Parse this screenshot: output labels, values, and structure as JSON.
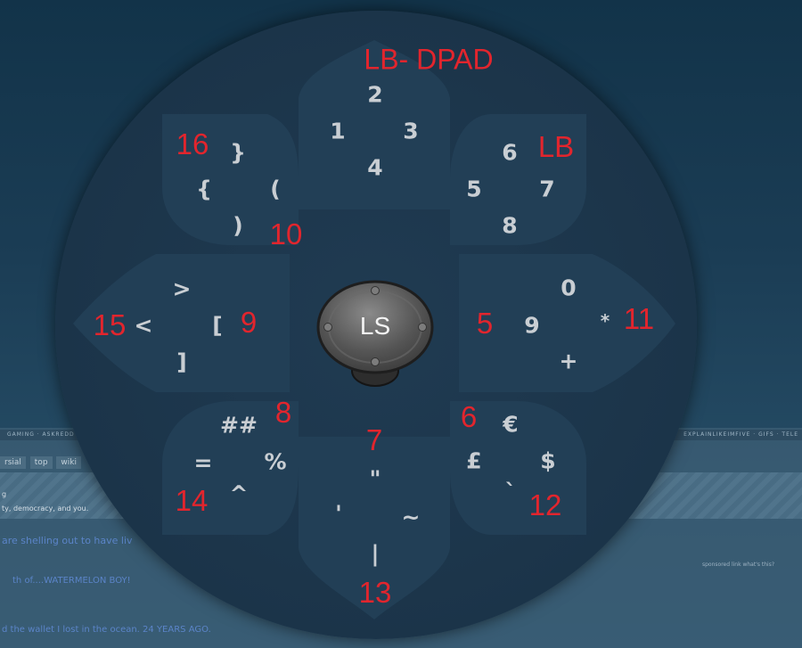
{
  "title": "LB- DPAD",
  "stick": {
    "label": "LS"
  },
  "groups": [
    {
      "id": "lbdpad",
      "keys": [
        "2",
        "1",
        "3",
        "4"
      ]
    },
    {
      "id": "lb",
      "label": "LB",
      "keys": [
        "6",
        "5",
        "7",
        "8"
      ]
    },
    {
      "id": "g16",
      "label": "16",
      "keys": [
        "}",
        "{",
        "(",
        ")"
      ]
    },
    {
      "id": "g10",
      "label": "10"
    },
    {
      "id": "g15",
      "label": "15",
      "keys": [
        ">",
        "<",
        "[",
        "]"
      ]
    },
    {
      "id": "g9",
      "label": "9"
    },
    {
      "id": "g5",
      "label": "5",
      "keys": [
        "0",
        "9",
        "*",
        "+"
      ]
    },
    {
      "id": "g11",
      "label": "11"
    },
    {
      "id": "g8",
      "label": "8",
      "keys": [
        "##",
        "=",
        "%",
        "^"
      ]
    },
    {
      "id": "g14",
      "label": "14"
    },
    {
      "id": "g7",
      "label": "7",
      "keys": [
        "\"",
        "'",
        "~",
        "|"
      ]
    },
    {
      "id": "g13",
      "label": "13"
    },
    {
      "id": "g6",
      "label": "6",
      "keys": [
        "€",
        "£",
        "$",
        "`"
      ]
    },
    {
      "id": "g12",
      "label": "12"
    }
  ],
  "background": {
    "bar_left": "GAMING · ASKREDD",
    "bar_right": "EXPLAINLIKEIMFIVE · GIFS · TELE",
    "tabs": [
      "rsial",
      "top",
      "wiki"
    ],
    "lines": [
      "g",
      "ty, democracy, and you.",
      "are shelling out to have liv",
      "th of....WATERMELON BOY!",
      "d the wallet I lost in the ocean. 24 YEARS AGO.",
      "sponsored link  what's this?"
    ]
  },
  "colors": {
    "label_red": "#e2252d",
    "glyph": "#c9ced3",
    "petal": "#223f56",
    "dial": "#1b3449"
  }
}
